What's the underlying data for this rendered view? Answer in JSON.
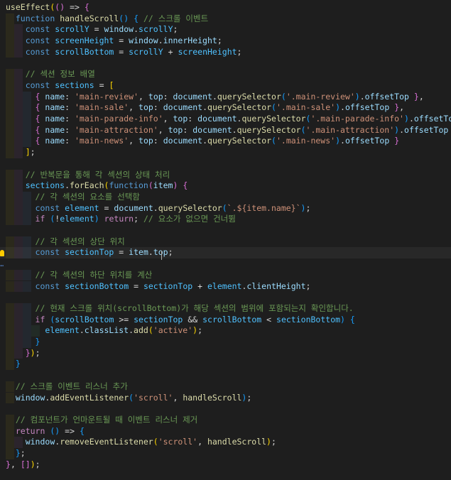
{
  "editor": {
    "language": "javascript",
    "colors": {
      "background": "#1e1e1e",
      "keyword": "#569cd6",
      "control": "#c586c0",
      "function": "#dcdcaa",
      "variable": "#9cdcfe",
      "constant": "#4fc1ff",
      "string": "#ce9178",
      "comment": "#6a9955"
    },
    "lines": [
      "useEffect(() => {",
      "  function handleScroll() { // 스크롤 이벤트",
      "    const scrollY = window.scrollY;",
      "    const screenHeight = window.innerHeight;",
      "    const scrollBottom = scrollY + screenHeight;",
      "",
      "    // 섹션 정보 배열",
      "    const sections = [",
      "      { name: 'main-review', top: document.querySelector('.main-review').offsetTop },",
      "      { name: 'main-sale', top: document.querySelector('.main-sale').offsetTop },",
      "      { name: 'main-parade-info', top: document.querySelector('.main-parade-info').offsetTop },",
      "      { name: 'main-attraction', top: document.querySelector('.main-attraction').offsetTop },",
      "      { name: 'main-news', top: document.querySelector('.main-news').offsetTop }",
      "    ];",
      "",
      "    // 반복문을 통해 각 섹션의 상태 처리",
      "    sections.forEach(function(item) {",
      "      // 각 섹션의 요소를 선택함",
      "      const element = document.querySelector(`.${item.name}`);",
      "      if (!element) return; // 요소가 없으면 건너뜀",
      "",
      "      // 각 섹션의 상단 위치",
      "      const sectionTop = item.top;",
      "",
      "      // 각 섹션의 하단 위치를 계산",
      "      const sectionBottom = sectionTop + element.clientHeight;",
      "",
      "      // 현재 스크롤 위치(scrollBottom)가 해당 섹션의 범위에 포함되는지 확인합니다.",
      "      if (scrollBottom >= sectionTop && scrollBottom < sectionBottom) {",
      "        element.classList.add('active');",
      "      }",
      "    });",
      "  }",
      "",
      "  // 스크롤 이벤트 리스너 추가",
      "  window.addEventListener('scroll', handleScroll);",
      "",
      "  // 컴포넌트가 언마운트될 때 이벤트 리스너 제거",
      "  return () => {",
      "    window.removeEventListener('scroll', handleScroll);",
      "  };",
      "}, []);"
    ],
    "cursor_line": 22,
    "lightbulb_icon": "lightbulb-icon",
    "fold_icon": "ellipsis-fold-icon"
  }
}
